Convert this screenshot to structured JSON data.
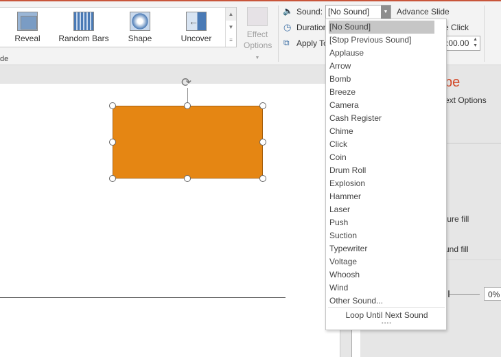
{
  "ribbon": {
    "transitions": [
      {
        "label": "Reveal",
        "icon": "reveal-transition-icon"
      },
      {
        "label": "Random Bars",
        "icon": "random-bars-transition-icon"
      },
      {
        "label": "Shape",
        "icon": "shape-transition-icon"
      },
      {
        "label": "Uncover",
        "icon": "uncover-transition-icon"
      }
    ],
    "effect_options": "Effect Options",
    "group_label_partial": "de",
    "timing": {
      "sound_label": "Sound:",
      "sound_value": "[No Sound]",
      "duration_label": "Duration",
      "apply_label": "Apply To",
      "advance_slide": "Advance Slide",
      "on_click": "e Click",
      "after_value": ":00.00"
    }
  },
  "sound_dropdown": {
    "options": [
      "[No Sound]",
      "[Stop Previous Sound]",
      "Applause",
      "Arrow",
      "Bomb",
      "Breeze",
      "Camera",
      "Cash Register",
      "Chime",
      "Click",
      "Coin",
      "Drum Roll",
      "Explosion",
      "Hammer",
      "Laser",
      "Push",
      "Suction",
      "Typewriter",
      "Voltage",
      "Whoosh",
      "Wind",
      "Other Sound..."
    ],
    "selected": "[No Sound]",
    "loop_label": "Loop Until Next Sound"
  },
  "format_pane": {
    "title_partial": "pe",
    "text_options_partial": "ext Options",
    "picture_fill_partial": "ture fill",
    "background_fill_partial": "und fill",
    "transparency_value": "0%"
  },
  "colors": {
    "shape_fill": "#e58613",
    "accent": "#c8553a"
  }
}
